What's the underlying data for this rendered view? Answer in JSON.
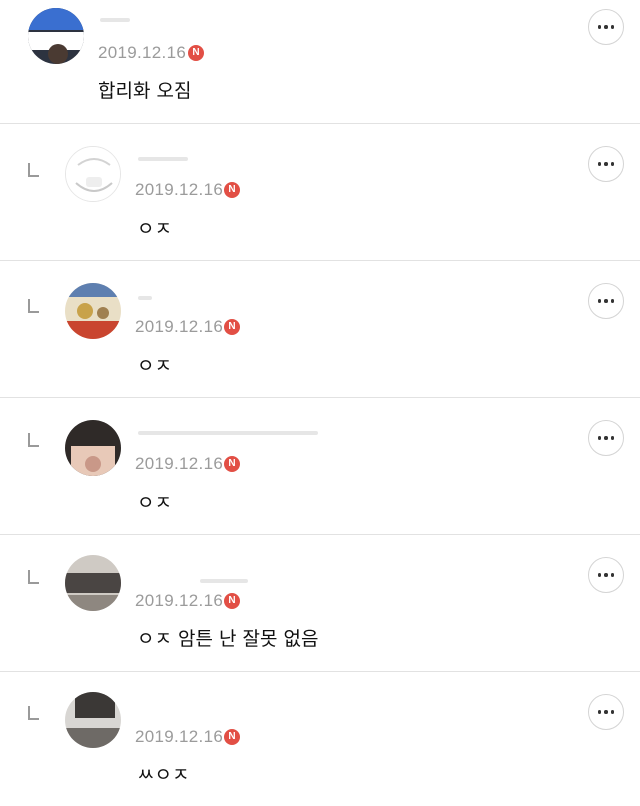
{
  "icon_more": "more-options-icon",
  "badge_color": "#e24f45",
  "comments": [
    {
      "date": "2019.12.16",
      "badge": "N",
      "text": "합리화 오짐",
      "is_reply": false
    },
    {
      "date": "2019.12.16",
      "badge": "N",
      "text": "ㅇㅈ",
      "is_reply": true
    },
    {
      "date": "2019.12.16",
      "badge": "N",
      "text": "ㅇㅈ",
      "is_reply": true
    },
    {
      "date": "2019.12.16",
      "badge": "N",
      "text": "ㅇㅈ",
      "is_reply": true
    },
    {
      "date": "2019.12.16",
      "badge": "N",
      "text": "ㅇㅈ 암튼 난 잘못 없음",
      "is_reply": true
    },
    {
      "date": "2019.12.16",
      "badge": "N",
      "text": "ㅆㅇㅈ",
      "is_reply": true
    }
  ]
}
